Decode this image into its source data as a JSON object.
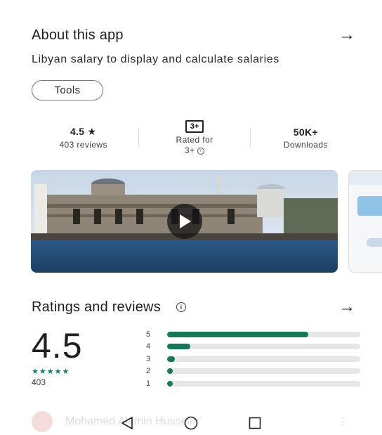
{
  "about": {
    "title": "About this app",
    "description": "Libyan salary to display and calculate salaries",
    "category_chip": "Tools"
  },
  "stats": {
    "rating_value": "4.5",
    "rating_star": "★",
    "reviews": "403 reviews",
    "content_rating_badge": "3+",
    "content_rating_label": "Rated for",
    "content_rating_sub": "3+",
    "downloads_value": "50K+",
    "downloads_label": "Downloads"
  },
  "ratings": {
    "title": "Ratings and reviews",
    "average": "4.5",
    "stars": "★★★★★",
    "total": "403",
    "distribution": [
      {
        "label": "5",
        "fraction": 0.73
      },
      {
        "label": "4",
        "fraction": 0.12
      },
      {
        "label": "3",
        "fraction": 0.04
      },
      {
        "label": "2",
        "fraction": 0.03
      },
      {
        "label": "1",
        "fraction": 0.03
      }
    ]
  },
  "review_preview": {
    "author": "Mohamed Alamin Husseini"
  },
  "colors": {
    "accent": "#137a58",
    "star": "#01875f",
    "track": "#e6e6e6"
  },
  "icons": {
    "arrow": "arrow-right-icon",
    "info": "info-icon",
    "play": "play-icon",
    "back": "nav-back-icon",
    "home": "nav-home-icon",
    "recents": "nav-recents-icon"
  }
}
